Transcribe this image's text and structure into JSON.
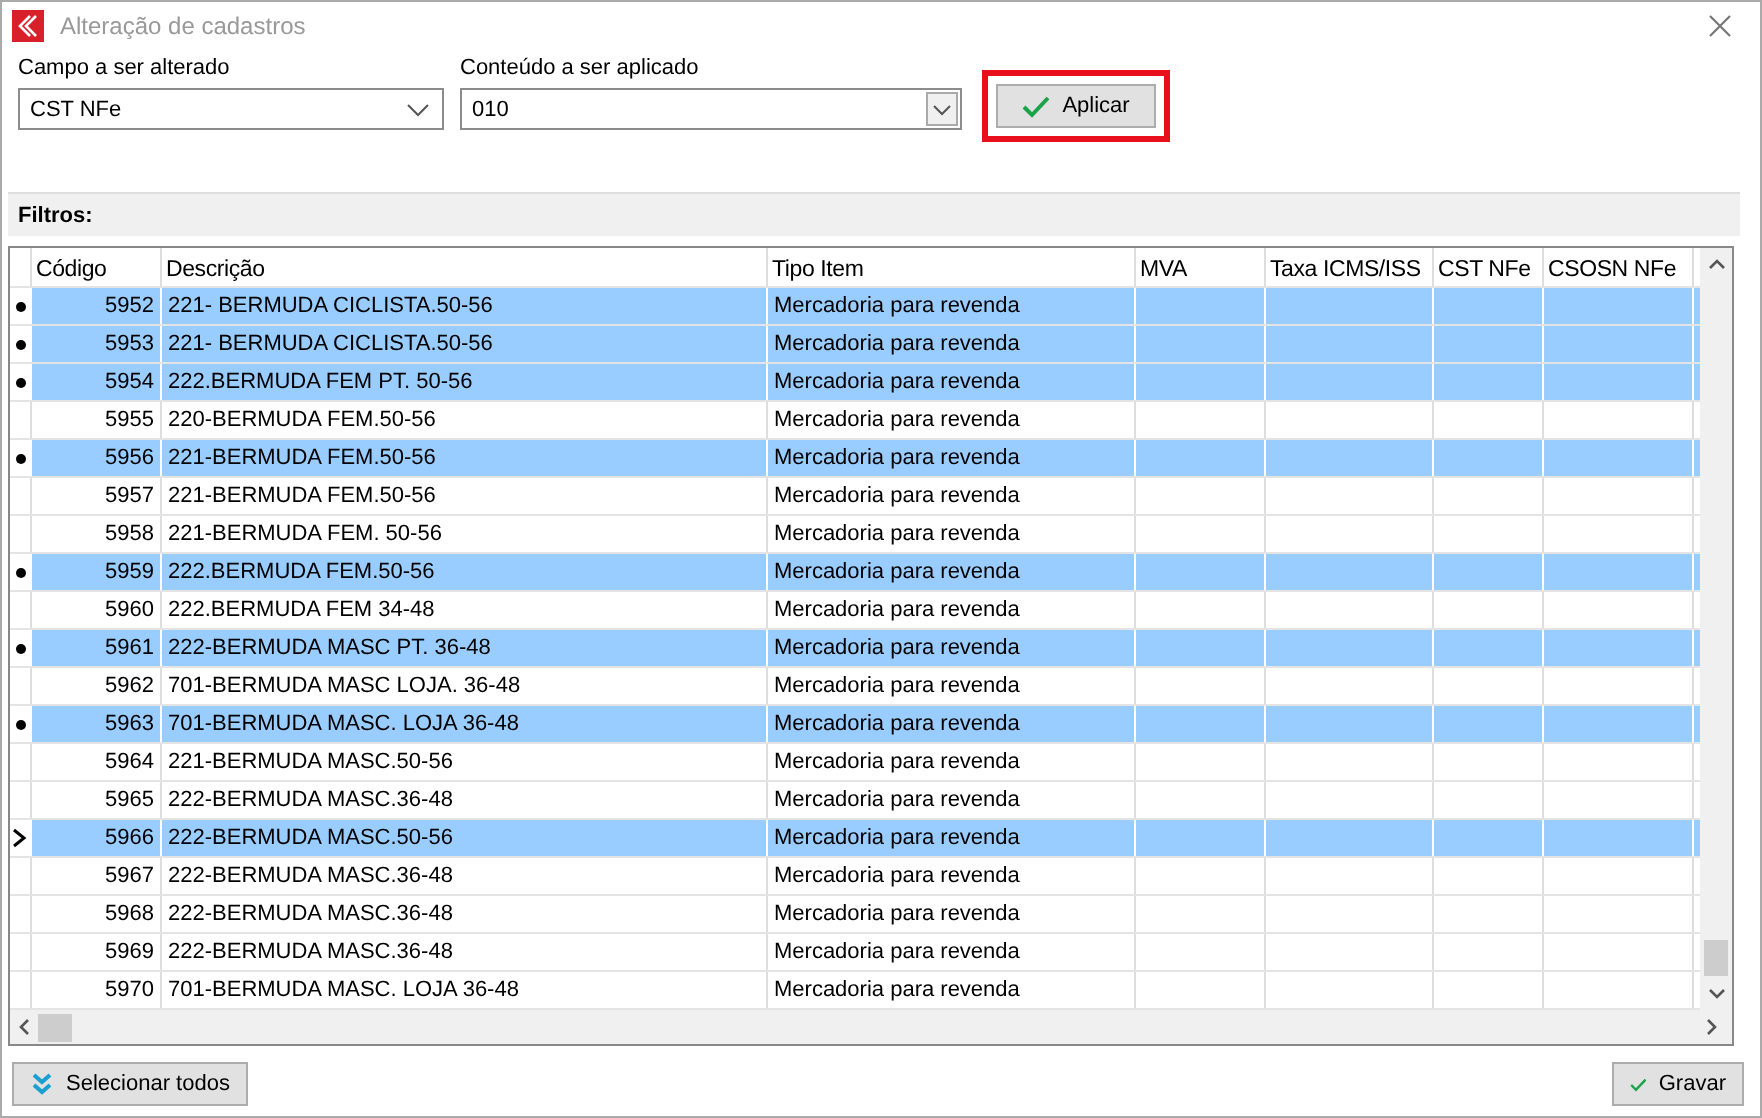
{
  "window": {
    "title": "Alteração de cadastros"
  },
  "fields": [
    {
      "label": "Campo a ser alterado",
      "value": "CST NFe",
      "kind": "plain"
    },
    {
      "label": "Conteúdo a ser aplicado",
      "value": "010",
      "kind": "boxed"
    }
  ],
  "apply_button": {
    "label": "Aplicar",
    "highlighted": true
  },
  "filters": {
    "label": "Filtros:"
  },
  "table": {
    "columns": [
      "Código",
      "Descrição",
      "Tipo Item",
      "MVA",
      "Taxa ICMS/ISS",
      "CST NFe",
      "CSOSN NFe"
    ],
    "rows": [
      {
        "code": "5952",
        "description": "221- BERMUDA CICLISTA.50-56",
        "type": "Mercadoria para revenda",
        "selected": true,
        "current": false
      },
      {
        "code": "5953",
        "description": "221- BERMUDA CICLISTA.50-56",
        "type": "Mercadoria para revenda",
        "selected": true,
        "current": false
      },
      {
        "code": "5954",
        "description": "222.BERMUDA FEM PT. 50-56",
        "type": "Mercadoria para revenda",
        "selected": true,
        "current": false
      },
      {
        "code": "5955",
        "description": "220-BERMUDA FEM.50-56",
        "type": "Mercadoria para revenda",
        "selected": false,
        "current": false
      },
      {
        "code": "5956",
        "description": "221-BERMUDA FEM.50-56",
        "type": "Mercadoria para revenda",
        "selected": true,
        "current": false
      },
      {
        "code": "5957",
        "description": "221-BERMUDA FEM.50-56",
        "type": "Mercadoria para revenda",
        "selected": false,
        "current": false
      },
      {
        "code": "5958",
        "description": "221-BERMUDA FEM. 50-56",
        "type": "Mercadoria para revenda",
        "selected": false,
        "current": false
      },
      {
        "code": "5959",
        "description": "222.BERMUDA FEM.50-56",
        "type": "Mercadoria para revenda",
        "selected": true,
        "current": false
      },
      {
        "code": "5960",
        "description": "222.BERMUDA FEM 34-48",
        "type": "Mercadoria para revenda",
        "selected": false,
        "current": false
      },
      {
        "code": "5961",
        "description": "222-BERMUDA MASC PT. 36-48",
        "type": "Mercadoria para revenda",
        "selected": true,
        "current": false
      },
      {
        "code": "5962",
        "description": "701-BERMUDA MASC LOJA. 36-48",
        "type": "Mercadoria para revenda",
        "selected": false,
        "current": false
      },
      {
        "code": "5963",
        "description": "701-BERMUDA MASC. LOJA 36-48",
        "type": "Mercadoria para revenda",
        "selected": true,
        "current": false
      },
      {
        "code": "5964",
        "description": "221-BERMUDA MASC.50-56",
        "type": "Mercadoria para revenda",
        "selected": false,
        "current": false
      },
      {
        "code": "5965",
        "description": "222-BERMUDA MASC.36-48",
        "type": "Mercadoria para revenda",
        "selected": false,
        "current": false
      },
      {
        "code": "5966",
        "description": "222-BERMUDA MASC.50-56",
        "type": "Mercadoria para revenda",
        "selected": true,
        "current": true
      },
      {
        "code": "5967",
        "description": "222-BERMUDA MASC.36-48",
        "type": "Mercadoria para revenda",
        "selected": false,
        "current": false
      },
      {
        "code": "5968",
        "description": "222-BERMUDA MASC.36-48",
        "type": "Mercadoria para revenda",
        "selected": false,
        "current": false
      },
      {
        "code": "5969",
        "description": "222-BERMUDA MASC.36-48",
        "type": "Mercadoria para revenda",
        "selected": false,
        "current": false
      },
      {
        "code": "5970",
        "description": "701-BERMUDA MASC. LOJA 36-48",
        "type": "Mercadoria para revenda",
        "selected": false,
        "current": false
      }
    ]
  },
  "buttons": [
    {
      "label": "Selecionar todos",
      "kind": "select-all"
    },
    {
      "label": "Gravar",
      "kind": "save"
    }
  ]
}
